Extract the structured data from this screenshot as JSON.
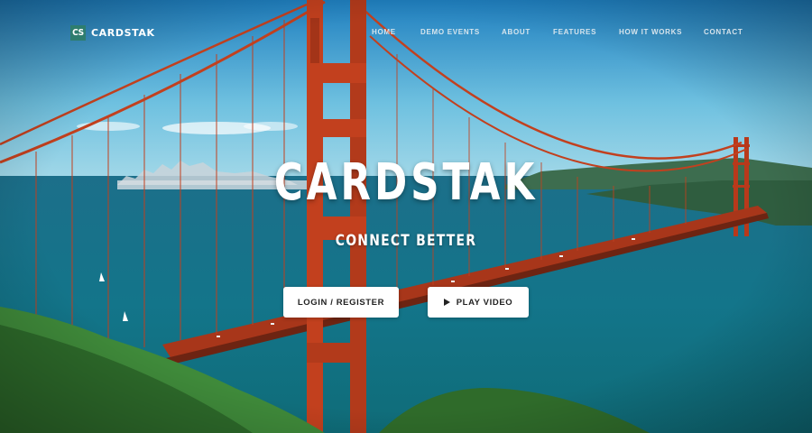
{
  "brand": {
    "mark": "CS",
    "name": "CARDSTAK"
  },
  "nav": {
    "items": [
      {
        "label": "HOME"
      },
      {
        "label": "DEMO EVENTS"
      },
      {
        "label": "ABOUT"
      },
      {
        "label": "FEATURES"
      },
      {
        "label": "HOW IT WORKS"
      },
      {
        "label": "CONTACT"
      }
    ]
  },
  "hero": {
    "title": "CARDSTAK",
    "subtitle": "CONNECT BETTER"
  },
  "cta": {
    "login_label": "LOGIN / REGISTER",
    "play_label": "PLAY VIDEO",
    "play_icon": "play-icon"
  },
  "colors": {
    "brand": "#2e7d6e",
    "bridge": "#c2401e",
    "sky": "#2b8ec4",
    "water": "#177a8e"
  }
}
